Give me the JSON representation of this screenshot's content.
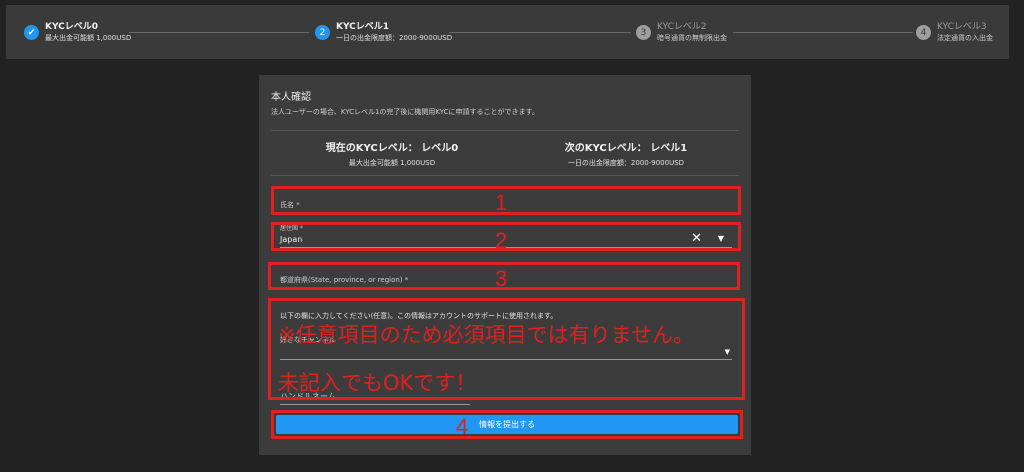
{
  "stepper": {
    "steps": [
      {
        "title": "KYCレベル0",
        "sub": "最大出金可能額 1,000USD",
        "state": "done",
        "icon": "✔"
      },
      {
        "title": "KYCレベル1",
        "sub": "一日の出金限度額：2000-9000USD",
        "state": "active",
        "icon": "2"
      },
      {
        "title": "KYCレベル2",
        "sub": "暗号通貨の無制限出金",
        "state": "pending",
        "icon": "3"
      },
      {
        "title": "KYCレベル3",
        "sub": "法定通貨の入出金",
        "state": "pending",
        "icon": "4"
      }
    ]
  },
  "card": {
    "title": "本人確認",
    "description": "法人ユーザーの場合、KYCレベル1の完了後に機関用KYCに申請することができます。",
    "current_level": {
      "title": "現在のKYCレベル： レベル0",
      "sub": "最大出金可能額 1,000USD"
    },
    "next_level": {
      "title": "次のKYCレベル： レベル1",
      "sub": "一日の出金限度額：2000-9000USD"
    }
  },
  "form": {
    "name_label": "氏名 *",
    "residence_label": "居住国 *",
    "residence_value": "Japan",
    "state_label": "都道府県(State, province, or region) *",
    "optional_note": "以下の欄に入力してください(任意)。この情報はアカウントのサポートに使用されます。",
    "optional_select_label": "好きなチャンネル",
    "handle_label": "ハンドルネーム",
    "submit_label": "情報を提出する"
  },
  "annotations": {
    "numbers": [
      "1",
      "2",
      "3",
      "4"
    ],
    "note_line1": "※任意項目のため必須項目では有りません。",
    "note_line2": "未記入でもOKです！",
    "color": "#e02020"
  },
  "colors": {
    "accent": "#2196f3",
    "background": "#222222",
    "card": "#3c3c3c"
  }
}
